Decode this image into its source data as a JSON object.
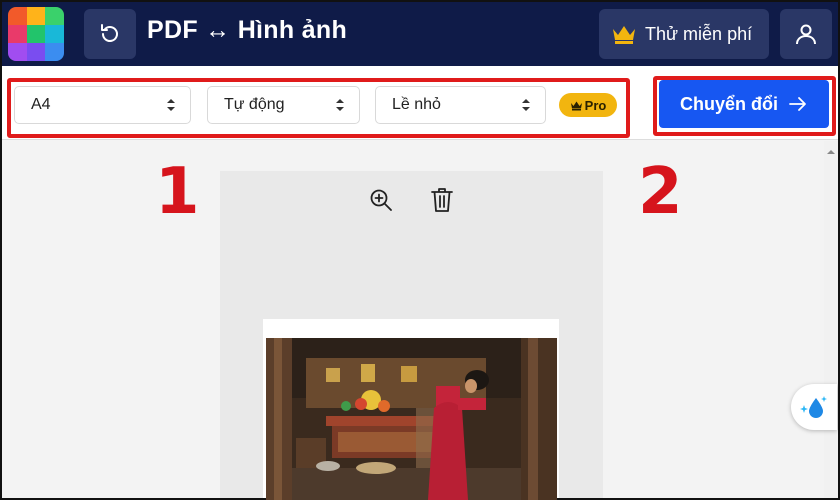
{
  "header": {
    "title": "PDF ↔ Hình ảnh",
    "try_free_label": "Thử miễn phí"
  },
  "toolbar": {
    "page_size": "A4",
    "orientation": "Tự động",
    "margin": "Lề nhỏ",
    "pro_label": "Pro",
    "convert_label": "Chuyển đổi"
  },
  "annotations": {
    "step1": "1",
    "step2": "2"
  },
  "icons": {
    "back": "undo-icon",
    "crown": "crown-icon",
    "user": "user-icon",
    "zoom": "zoom-in-icon",
    "delete": "trash-icon",
    "arrow": "arrow-right-icon",
    "assistant": "sparkle-drop-icon"
  },
  "colors": {
    "header_bg": "#0f1b48",
    "button_bg": "#2a3766",
    "accent_blue": "#1757f2",
    "highlight_red": "#e01b1b",
    "pro_gold": "#f2b50f"
  }
}
